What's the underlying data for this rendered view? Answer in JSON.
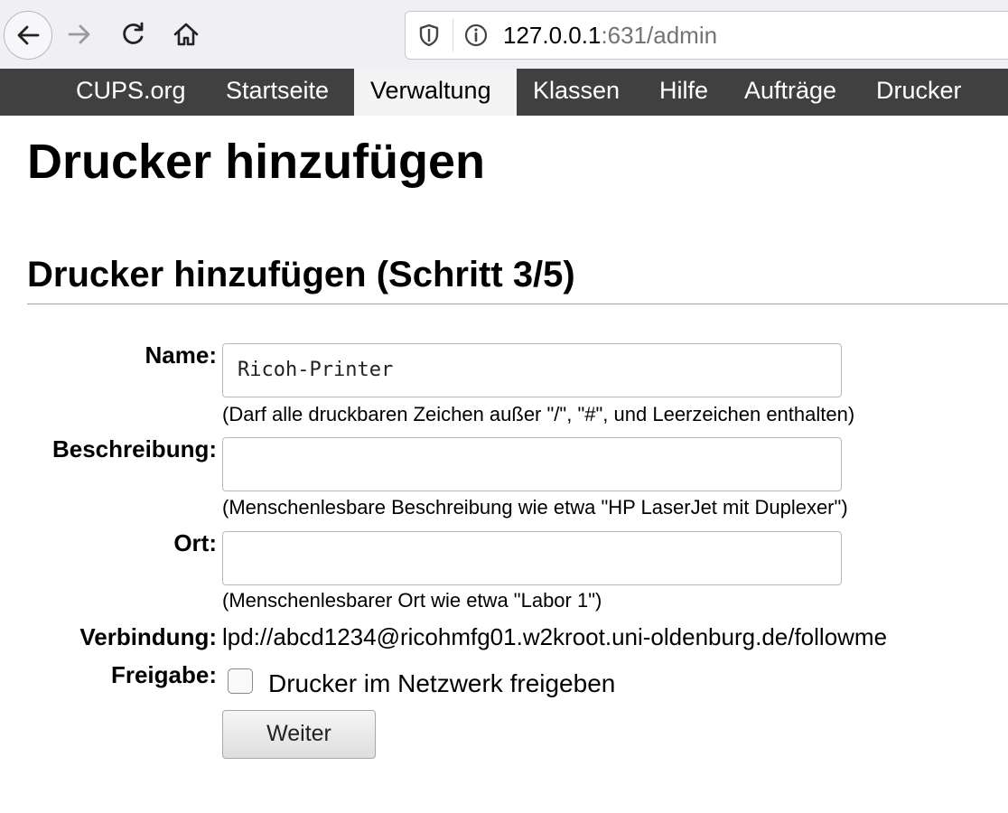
{
  "browser": {
    "url_host": "127.0.0.1",
    "url_rest": ":631/admin"
  },
  "nav": {
    "items": [
      {
        "label": "CUPS.org"
      },
      {
        "label": "Startseite"
      },
      {
        "label": "Verwaltung",
        "active": true
      },
      {
        "label": "Klassen"
      },
      {
        "label": "Hilfe"
      },
      {
        "label": "Aufträge"
      },
      {
        "label": "Drucker"
      }
    ]
  },
  "page": {
    "title": "Drucker hinzufügen",
    "section_title": "Drucker hinzufügen (Schritt 3/5)"
  },
  "form": {
    "name_label": "Name:",
    "name_value": "Ricoh-Printer",
    "name_hint": "(Darf alle druckbaren Zeichen außer \"/\", \"#\", und Leerzeichen enthalten)",
    "description_label": "Beschreibung:",
    "description_value": "",
    "description_hint": "(Menschenlesbare Beschreibung wie etwa \"HP LaserJet mit Duplexer\")",
    "location_label": "Ort:",
    "location_value": "",
    "location_hint": "(Menschenlesbarer Ort wie etwa \"Labor 1\")",
    "connection_label": "Verbindung:",
    "connection_value": "lpd://abcd1234@ricohmfg01.w2kroot.uni-oldenburg.de/followme",
    "share_label": "Freigabe:",
    "share_checkbox_label": "Drucker im Netzwerk freigeben",
    "share_checked": false,
    "submit_label": "Weiter"
  },
  "colors": {
    "nav_bg": "#404040",
    "nav_active_bg": "#f4f4f4",
    "toolbar_bg": "#f0f0f4"
  },
  "icons": [
    "back-arrow-icon",
    "forward-arrow-icon",
    "reload-icon",
    "home-icon",
    "shield-icon",
    "info-icon"
  ]
}
